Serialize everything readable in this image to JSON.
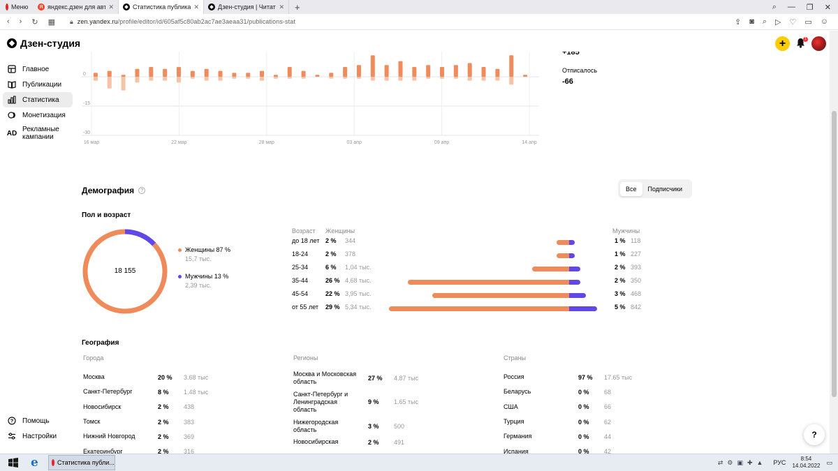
{
  "browser": {
    "menu_label": "Меню",
    "tabs": [
      {
        "title": "яндекс.дзен для авторов о",
        "active": false
      },
      {
        "title": "Статистика публикаций | Д",
        "active": true
      },
      {
        "title": "Дзен-студия | Читатели Д",
        "active": false
      }
    ],
    "url_host": "zen.yandex.ru",
    "url_path": "/profile/editor/id/605af5c80ab2ac7ae3aeaa31/publications-stat"
  },
  "header": {
    "logo_text": "Дзен-студия",
    "notification_count": "1"
  },
  "sidebar": {
    "items": [
      {
        "label": "Главное",
        "icon": "home-icon"
      },
      {
        "label": "Публикации",
        "icon": "book-icon"
      },
      {
        "label": "Статистика",
        "icon": "stats-icon",
        "active": true
      },
      {
        "label": "Монетизация",
        "icon": "coins-icon"
      },
      {
        "label": "Рекламные кампании",
        "icon": "ad-icon"
      }
    ],
    "bottom": [
      {
        "label": "Помощь",
        "icon": "help-icon"
      },
      {
        "label": "Настройки",
        "icon": "settings-icon"
      }
    ]
  },
  "summary": {
    "top_value_cut": "+185",
    "unsub_label": "Отписалось",
    "unsub_value": "-66"
  },
  "chart_data": {
    "type": "bar",
    "y_ticks": [
      "0",
      "-15",
      "-30"
    ],
    "ylim": [
      -30,
      15
    ],
    "x_tick_labels": [
      "16 мар",
      "22 мар",
      "28 мар",
      "03 апр",
      "09 апр",
      "14 апр"
    ],
    "colors": {
      "positive": "#f08c5c",
      "negative": "#f6c2a8"
    },
    "series": [
      {
        "values": [
          2,
          3,
          1,
          4,
          5,
          4,
          5,
          3,
          4,
          3,
          2,
          2,
          3,
          1,
          5,
          3,
          1,
          2,
          5,
          6,
          11,
          6,
          8,
          5,
          6,
          5,
          6,
          7,
          5,
          4,
          11,
          1
        ]
      },
      {
        "values": [
          -2,
          -6,
          -7,
          -3,
          -2,
          -2,
          -3,
          -1,
          -2,
          -2,
          -1,
          -1,
          -2,
          -1,
          -1,
          -1,
          0,
          -1,
          -1,
          -1,
          -2,
          -2,
          -2,
          -2,
          -1,
          -1,
          -1,
          -2,
          -2,
          -2,
          -4,
          0
        ]
      }
    ]
  },
  "demography": {
    "title": "Демография",
    "seg_all": "Все",
    "seg_subscribers": "Подписчики",
    "sex_age_title": "Пол и возраст",
    "total": "18 155",
    "female": {
      "label": "Женщины 87 %",
      "sub": "15,7 тыс.",
      "color": "#ef8a5b",
      "share": 0.87
    },
    "male": {
      "label": "Мужчины 13 %",
      "sub": "2,39 тыс.",
      "color": "#6047e8",
      "share": 0.13
    },
    "table_head": {
      "age": "Возраст",
      "female": "Женщины",
      "male": "Мужчины"
    },
    "rows": [
      {
        "age": "до 18 лет",
        "fpct": "2 %",
        "fcnt": "344",
        "mpct": "1 %",
        "mcnt": "118",
        "f": 2,
        "m": 1
      },
      {
        "age": "18-24",
        "fpct": "2 %",
        "fcnt": "378",
        "mpct": "1 %",
        "mcnt": "227",
        "f": 2,
        "m": 1
      },
      {
        "age": "25-34",
        "fpct": "6 %",
        "fcnt": "1,04 тыс.",
        "mpct": "2 %",
        "mcnt": "393",
        "f": 6,
        "m": 2
      },
      {
        "age": "35-44",
        "fpct": "26 %",
        "fcnt": "4,68 тыс.",
        "mpct": "2 %",
        "mcnt": "350",
        "f": 26,
        "m": 2
      },
      {
        "age": "45-54",
        "fpct": "22 %",
        "fcnt": "3,95 тыс.",
        "mpct": "3 %",
        "mcnt": "468",
        "f": 22,
        "m": 3
      },
      {
        "age": "от 55 лет",
        "fpct": "29 %",
        "fcnt": "5,34 тыс.",
        "mpct": "5 %",
        "mcnt": "842",
        "f": 29,
        "m": 5
      }
    ]
  },
  "geography": {
    "title": "География",
    "cities": {
      "head": "Города",
      "rows": [
        {
          "name": "Москва",
          "pct": "20 %",
          "cnt": "3.68 тыс"
        },
        {
          "name": "Санкт-Петербург",
          "pct": "8 %",
          "cnt": "1.48 тыс"
        },
        {
          "name": "Новосибирск",
          "pct": "2 %",
          "cnt": "438"
        },
        {
          "name": "Томск",
          "pct": "2 %",
          "cnt": "383"
        },
        {
          "name": "Нижний Новгород",
          "pct": "2 %",
          "cnt": "369"
        },
        {
          "name": "Екатеринбург",
          "pct": "2 %",
          "cnt": "316"
        }
      ]
    },
    "regions": {
      "head": "Регионы",
      "rows": [
        {
          "name": "Москва и Московская область",
          "pct": "27 %",
          "cnt": "4.87 тыс"
        },
        {
          "name": "Санкт-Петербург и Ленинградская область",
          "pct": "9 %",
          "cnt": "1.65 тыс"
        },
        {
          "name": "Нижегородская область",
          "pct": "3 %",
          "cnt": "500"
        },
        {
          "name": "Новосибирская",
          "pct": "2 %",
          "cnt": "491"
        }
      ]
    },
    "countries": {
      "head": "Страны",
      "rows": [
        {
          "name": "Россия",
          "pct": "97 %",
          "cnt": "17.65 тыс"
        },
        {
          "name": "Беларусь",
          "pct": "0 %",
          "cnt": "68"
        },
        {
          "name": "США",
          "pct": "0 %",
          "cnt": "66"
        },
        {
          "name": "Турция",
          "pct": "0 %",
          "cnt": "62"
        },
        {
          "name": "Германия",
          "pct": "0 %",
          "cnt": "44"
        },
        {
          "name": "Испания",
          "pct": "0 %",
          "cnt": "42"
        }
      ]
    }
  },
  "help_fab": "?",
  "taskbar": {
    "opera_task": "Статистика публи...",
    "lang": "РУС",
    "time": "8:54",
    "date": "14.04.2022"
  }
}
